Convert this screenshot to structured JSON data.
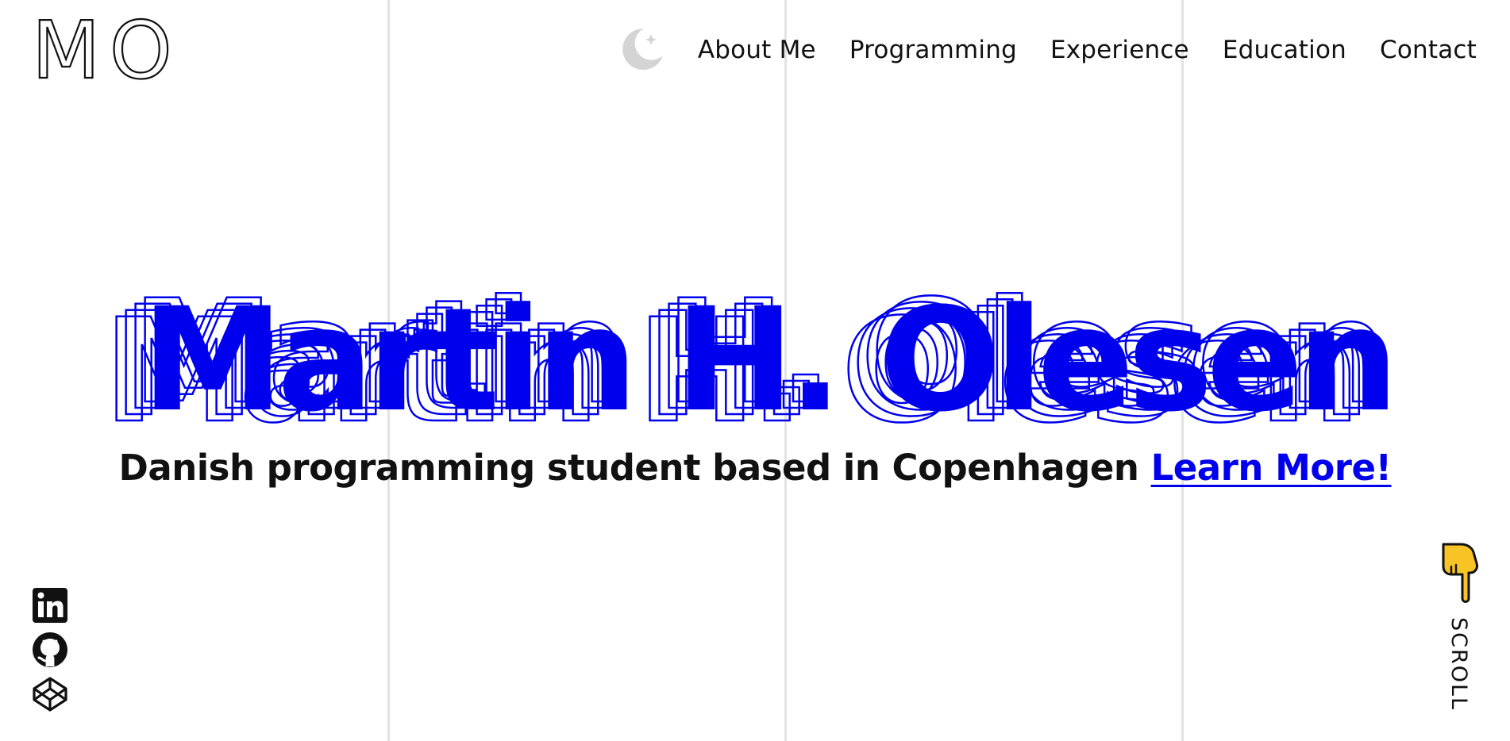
{
  "logo": {
    "initials": [
      "M",
      "O"
    ]
  },
  "header": {
    "theme_toggle_icon": "moon-icon",
    "nav": [
      {
        "label": "About Me"
      },
      {
        "label": "Programming"
      },
      {
        "label": "Experience"
      },
      {
        "label": "Education"
      },
      {
        "label": "Contact"
      }
    ]
  },
  "hero": {
    "name": "Martin H. Olesen",
    "tagline": "Danish programming student based in Copenhagen",
    "cta_link": "Learn More!"
  },
  "social": [
    {
      "icon": "linkedin-icon"
    },
    {
      "icon": "github-icon"
    },
    {
      "icon": "codepen-icon"
    }
  ],
  "scroll": {
    "icon": "pointing-down-hand-icon",
    "label": "SCROLL"
  },
  "colors": {
    "accent": "#0000ee",
    "text": "#111111",
    "grid": "#e3e3e3",
    "moon": "#d4d4d4",
    "hand": "#f7c325"
  }
}
